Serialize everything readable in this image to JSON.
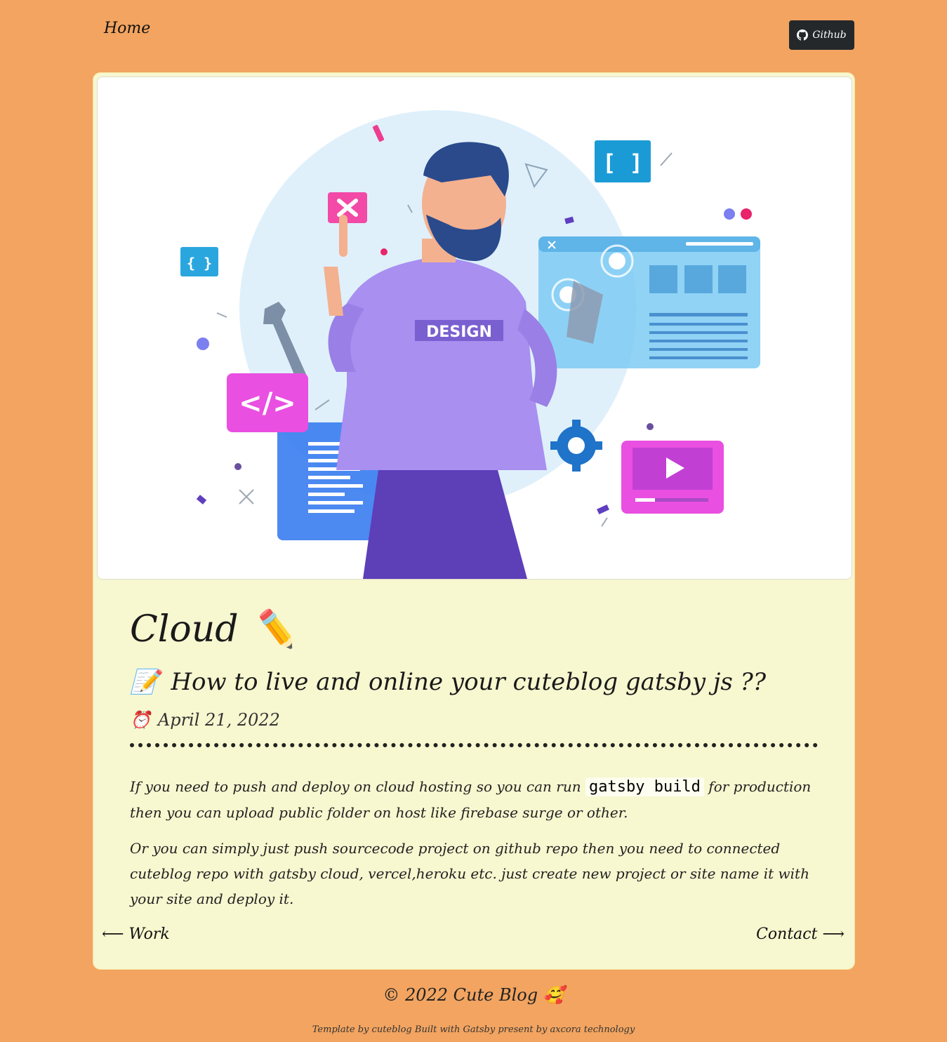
{
  "nav": {
    "home_label": "Home",
    "github_label": "Github"
  },
  "hero": {
    "shirt_text": "DESIGN",
    "code_icon_text": "</>",
    "bracket_text_1": "[ ]",
    "bracket_text_2": "{ }"
  },
  "post": {
    "category": "Cloud",
    "category_emoji": "✏️",
    "title_emoji": "📝",
    "title": "How to live and online your cuteblog gatsby js ??",
    "date_emoji": "⏰",
    "date": "April 21, 2022",
    "para1_before": "If you need to push and deploy on cloud hosting so you can run ",
    "para1_code": "gatsby build",
    "para1_after": " for production then you can upload public folder on host like firebase surge or other.",
    "para2": "Or you can simply just push sourcecode project on github repo then you need to connected cuteblog repo with gatsby cloud, vercel,heroku etc. just create new project or site name it with your site and deploy it."
  },
  "pager": {
    "prev_label": "⟵ Work",
    "next_label": "Contact ⟶"
  },
  "footer": {
    "copyright": "© 2022 Cute Blog",
    "emoji": "🥰",
    "credit_prefix": "Template by",
    "credit_template": "cuteblog",
    "credit_mid1": "Built with",
    "credit_gatsby": "Gatsby",
    "credit_mid2": "present by",
    "credit_company": "axcora technology"
  },
  "colors": {
    "background": "#f2a460",
    "card": "#f7f7d0",
    "button": "#24282b"
  }
}
